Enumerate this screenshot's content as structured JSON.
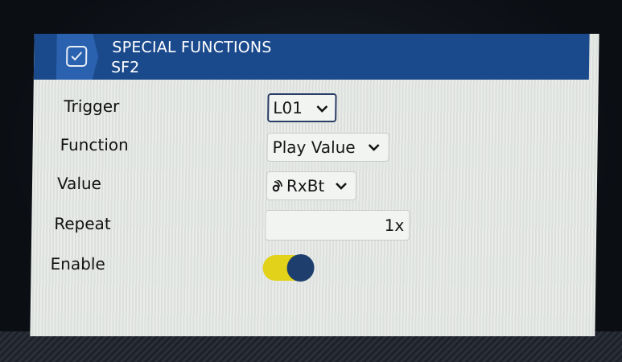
{
  "header": {
    "title": "SPECIAL FUNCTIONS",
    "subtitle": "SF2",
    "icon": "checkbox-icon",
    "bg_color": "#1b4a8c"
  },
  "rows": {
    "trigger": {
      "label": "Trigger",
      "value": "L01"
    },
    "function": {
      "label": "Function",
      "value": "Play Value"
    },
    "value": {
      "label": "Value",
      "value": "RxBt",
      "icon": "signal-icon"
    },
    "repeat": {
      "label": "Repeat",
      "value": "1x"
    },
    "enable": {
      "label": "Enable",
      "state": "on",
      "track_color": "#e3d21a",
      "knob_color": "#1e3f6e"
    }
  }
}
